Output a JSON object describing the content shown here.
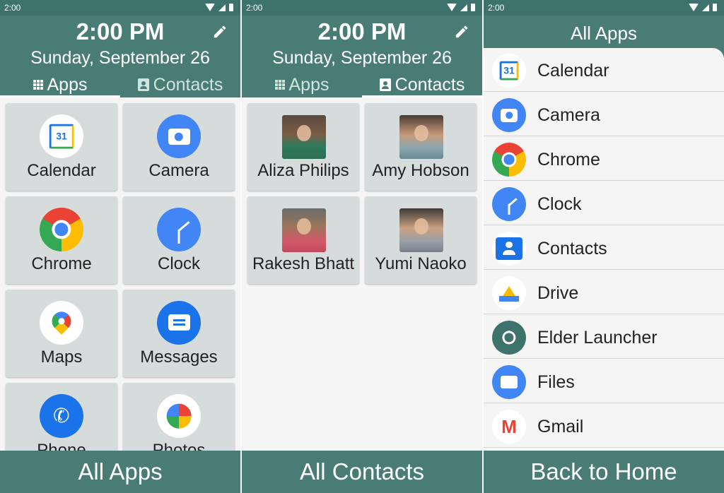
{
  "status_time": "2:00",
  "header": {
    "time": "2:00 PM",
    "date": "Sunday, September 26"
  },
  "tabs": {
    "apps": "Apps",
    "contacts": "Contacts"
  },
  "apps_grid": [
    {
      "label": "Calendar",
      "icon": "calendar-icon"
    },
    {
      "label": "Camera",
      "icon": "camera-icon"
    },
    {
      "label": "Chrome",
      "icon": "chrome-icon"
    },
    {
      "label": "Clock",
      "icon": "clock-icon"
    },
    {
      "label": "Maps",
      "icon": "maps-icon"
    },
    {
      "label": "Messages",
      "icon": "messages-icon"
    },
    {
      "label": "Phone",
      "icon": "phone-icon"
    },
    {
      "label": "Photos",
      "icon": "photos-icon"
    }
  ],
  "contacts_grid": [
    {
      "name": "Aliza Philips"
    },
    {
      "name": "Amy Hobson"
    },
    {
      "name": "Rakesh Bhatt"
    },
    {
      "name": "Yumi Naoko"
    }
  ],
  "all_apps": {
    "title": "All Apps",
    "items": [
      {
        "label": "Calendar",
        "icon": "calendar-icon"
      },
      {
        "label": "Camera",
        "icon": "camera-icon"
      },
      {
        "label": "Chrome",
        "icon": "chrome-icon"
      },
      {
        "label": "Clock",
        "icon": "clock-icon"
      },
      {
        "label": "Contacts",
        "icon": "contacts-icon"
      },
      {
        "label": "Drive",
        "icon": "drive-icon"
      },
      {
        "label": "Elder Launcher",
        "icon": "elder-launcher-icon"
      },
      {
        "label": "Files",
        "icon": "files-icon"
      },
      {
        "label": "Gmail",
        "icon": "gmail-icon"
      }
    ]
  },
  "bottom": {
    "all_apps": "All Apps",
    "all_contacts": "All Contacts",
    "back_home": "Back to Home"
  },
  "colors": {
    "header": "#4a7c76",
    "statusbar": "#3e736d",
    "tile": "#d6dcdc",
    "background": "#f5f5f5"
  }
}
